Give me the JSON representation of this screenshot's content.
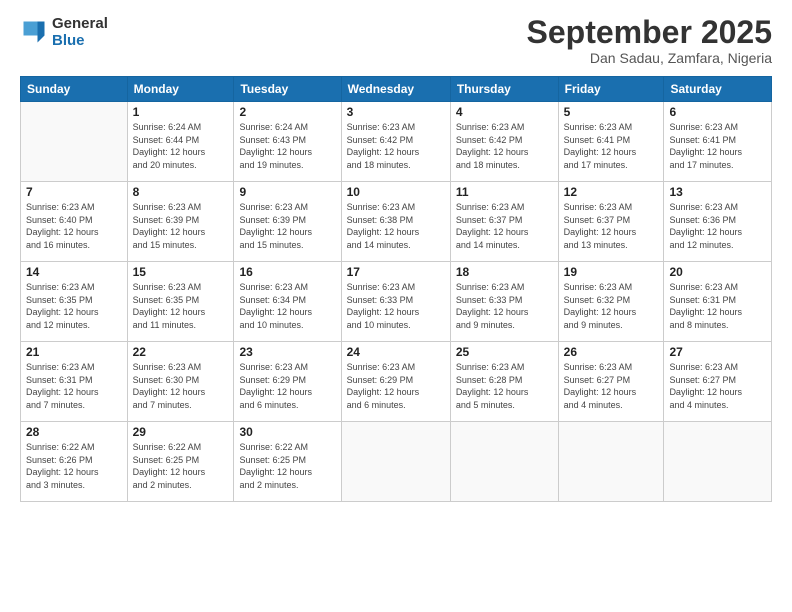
{
  "logo": {
    "line1": "General",
    "line2": "Blue"
  },
  "title": "September 2025",
  "subtitle": "Dan Sadau, Zamfara, Nigeria",
  "days_header": [
    "Sunday",
    "Monday",
    "Tuesday",
    "Wednesday",
    "Thursday",
    "Friday",
    "Saturday"
  ],
  "weeks": [
    [
      {
        "day": "",
        "info": ""
      },
      {
        "day": "1",
        "info": "Sunrise: 6:24 AM\nSunset: 6:44 PM\nDaylight: 12 hours\nand 20 minutes."
      },
      {
        "day": "2",
        "info": "Sunrise: 6:24 AM\nSunset: 6:43 PM\nDaylight: 12 hours\nand 19 minutes."
      },
      {
        "day": "3",
        "info": "Sunrise: 6:23 AM\nSunset: 6:42 PM\nDaylight: 12 hours\nand 18 minutes."
      },
      {
        "day": "4",
        "info": "Sunrise: 6:23 AM\nSunset: 6:42 PM\nDaylight: 12 hours\nand 18 minutes."
      },
      {
        "day": "5",
        "info": "Sunrise: 6:23 AM\nSunset: 6:41 PM\nDaylight: 12 hours\nand 17 minutes."
      },
      {
        "day": "6",
        "info": "Sunrise: 6:23 AM\nSunset: 6:41 PM\nDaylight: 12 hours\nand 17 minutes."
      }
    ],
    [
      {
        "day": "7",
        "info": "Sunrise: 6:23 AM\nSunset: 6:40 PM\nDaylight: 12 hours\nand 16 minutes."
      },
      {
        "day": "8",
        "info": "Sunrise: 6:23 AM\nSunset: 6:39 PM\nDaylight: 12 hours\nand 15 minutes."
      },
      {
        "day": "9",
        "info": "Sunrise: 6:23 AM\nSunset: 6:39 PM\nDaylight: 12 hours\nand 15 minutes."
      },
      {
        "day": "10",
        "info": "Sunrise: 6:23 AM\nSunset: 6:38 PM\nDaylight: 12 hours\nand 14 minutes."
      },
      {
        "day": "11",
        "info": "Sunrise: 6:23 AM\nSunset: 6:37 PM\nDaylight: 12 hours\nand 14 minutes."
      },
      {
        "day": "12",
        "info": "Sunrise: 6:23 AM\nSunset: 6:37 PM\nDaylight: 12 hours\nand 13 minutes."
      },
      {
        "day": "13",
        "info": "Sunrise: 6:23 AM\nSunset: 6:36 PM\nDaylight: 12 hours\nand 12 minutes."
      }
    ],
    [
      {
        "day": "14",
        "info": "Sunrise: 6:23 AM\nSunset: 6:35 PM\nDaylight: 12 hours\nand 12 minutes."
      },
      {
        "day": "15",
        "info": "Sunrise: 6:23 AM\nSunset: 6:35 PM\nDaylight: 12 hours\nand 11 minutes."
      },
      {
        "day": "16",
        "info": "Sunrise: 6:23 AM\nSunset: 6:34 PM\nDaylight: 12 hours\nand 10 minutes."
      },
      {
        "day": "17",
        "info": "Sunrise: 6:23 AM\nSunset: 6:33 PM\nDaylight: 12 hours\nand 10 minutes."
      },
      {
        "day": "18",
        "info": "Sunrise: 6:23 AM\nSunset: 6:33 PM\nDaylight: 12 hours\nand 9 minutes."
      },
      {
        "day": "19",
        "info": "Sunrise: 6:23 AM\nSunset: 6:32 PM\nDaylight: 12 hours\nand 9 minutes."
      },
      {
        "day": "20",
        "info": "Sunrise: 6:23 AM\nSunset: 6:31 PM\nDaylight: 12 hours\nand 8 minutes."
      }
    ],
    [
      {
        "day": "21",
        "info": "Sunrise: 6:23 AM\nSunset: 6:31 PM\nDaylight: 12 hours\nand 7 minutes."
      },
      {
        "day": "22",
        "info": "Sunrise: 6:23 AM\nSunset: 6:30 PM\nDaylight: 12 hours\nand 7 minutes."
      },
      {
        "day": "23",
        "info": "Sunrise: 6:23 AM\nSunset: 6:29 PM\nDaylight: 12 hours\nand 6 minutes."
      },
      {
        "day": "24",
        "info": "Sunrise: 6:23 AM\nSunset: 6:29 PM\nDaylight: 12 hours\nand 6 minutes."
      },
      {
        "day": "25",
        "info": "Sunrise: 6:23 AM\nSunset: 6:28 PM\nDaylight: 12 hours\nand 5 minutes."
      },
      {
        "day": "26",
        "info": "Sunrise: 6:23 AM\nSunset: 6:27 PM\nDaylight: 12 hours\nand 4 minutes."
      },
      {
        "day": "27",
        "info": "Sunrise: 6:23 AM\nSunset: 6:27 PM\nDaylight: 12 hours\nand 4 minutes."
      }
    ],
    [
      {
        "day": "28",
        "info": "Sunrise: 6:22 AM\nSunset: 6:26 PM\nDaylight: 12 hours\nand 3 minutes."
      },
      {
        "day": "29",
        "info": "Sunrise: 6:22 AM\nSunset: 6:25 PM\nDaylight: 12 hours\nand 2 minutes."
      },
      {
        "day": "30",
        "info": "Sunrise: 6:22 AM\nSunset: 6:25 PM\nDaylight: 12 hours\nand 2 minutes."
      },
      {
        "day": "",
        "info": ""
      },
      {
        "day": "",
        "info": ""
      },
      {
        "day": "",
        "info": ""
      },
      {
        "day": "",
        "info": ""
      }
    ]
  ]
}
